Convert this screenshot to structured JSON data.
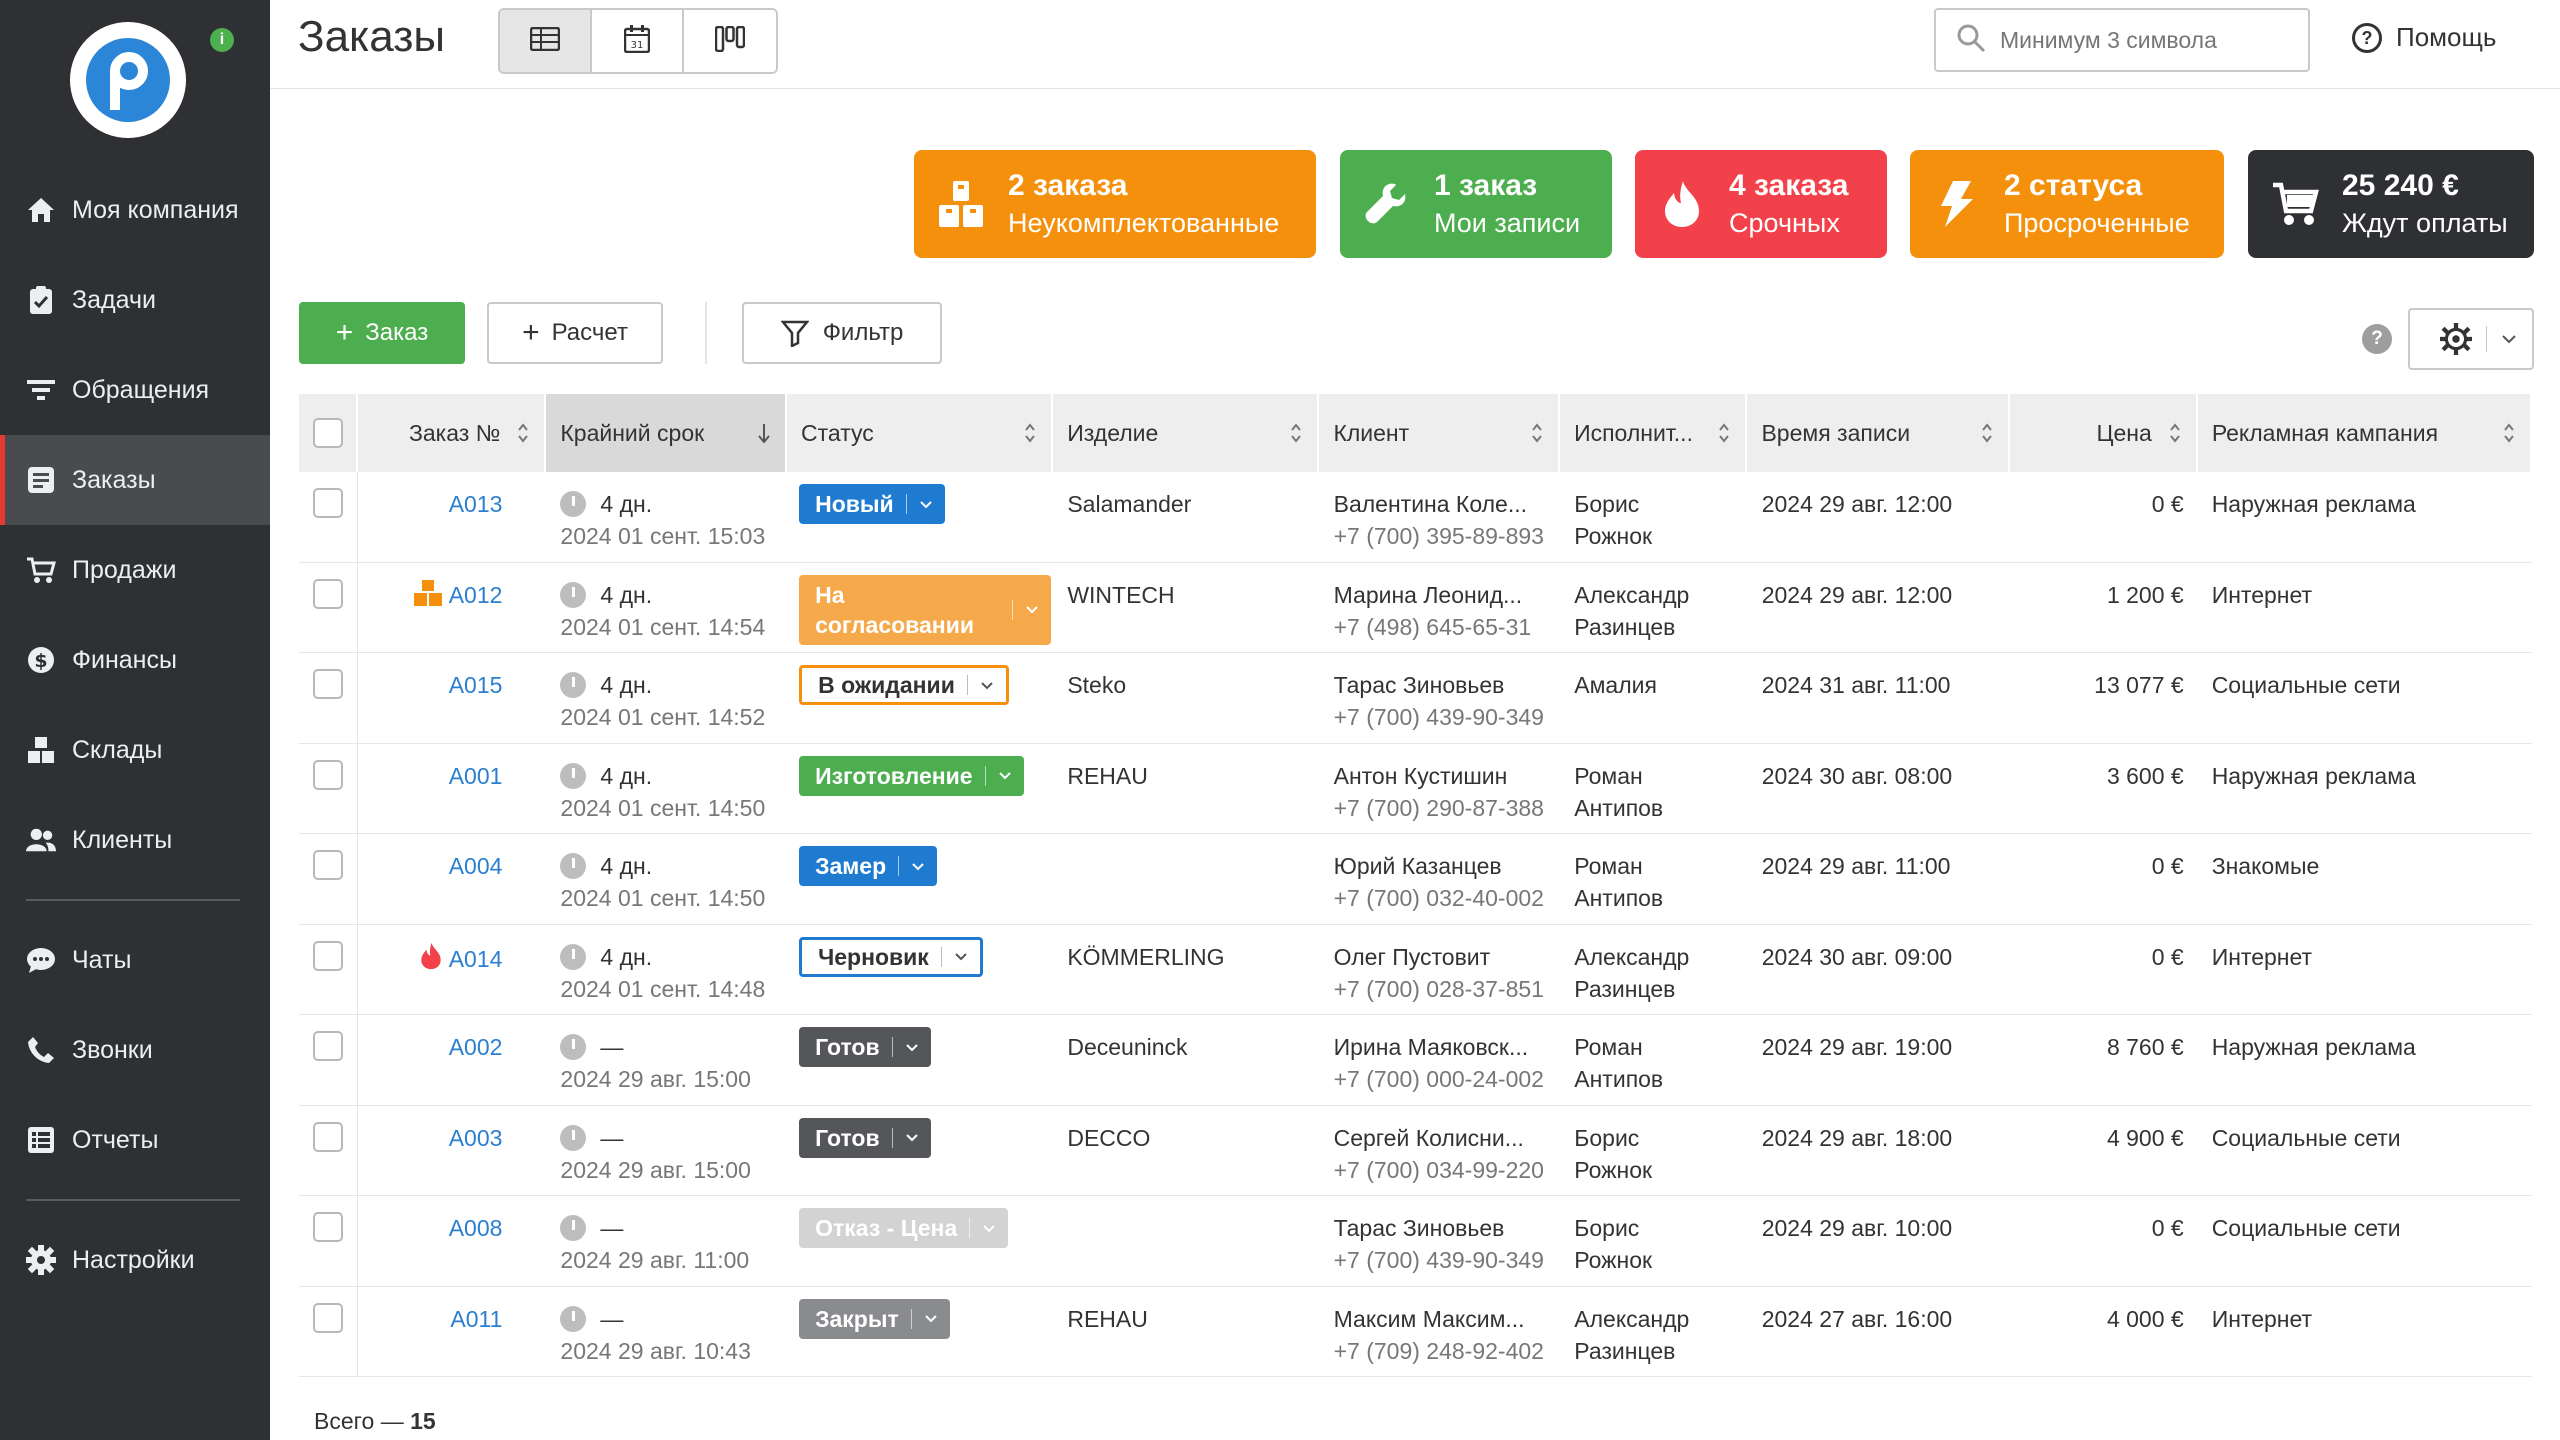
{
  "sidebar": {
    "items": [
      {
        "label": "Моя компания",
        "icon": "home-icon"
      },
      {
        "label": "Задачи",
        "icon": "clipboard-check-icon"
      },
      {
        "label": "Обращения",
        "icon": "funnel-lines-icon"
      },
      {
        "label": "Заказы",
        "icon": "orders-icon",
        "active": true
      },
      {
        "label": "Продажи",
        "icon": "cart-icon"
      },
      {
        "label": "Финансы",
        "icon": "dollar-icon"
      },
      {
        "label": "Склады",
        "icon": "boxes-icon"
      },
      {
        "label": "Клиенты",
        "icon": "users-icon"
      },
      {
        "label": "Чаты",
        "icon": "chat-icon"
      },
      {
        "label": "Звонки",
        "icon": "phone-icon"
      },
      {
        "label": "Отчеты",
        "icon": "reports-icon"
      },
      {
        "label": "Настройки",
        "icon": "gear-icon"
      }
    ]
  },
  "header": {
    "title": "Заказы",
    "search_placeholder": "Минимум 3 символа",
    "help_label": "Помощь"
  },
  "cards": [
    {
      "line1": "2 заказа",
      "line2": "Неукомплектованные",
      "color": "#f4900c",
      "icon": "boxes-icon"
    },
    {
      "line1": "1 заказ",
      "line2": "Мои записи",
      "color": "#4cae4f",
      "icon": "wrench-icon"
    },
    {
      "line1": "4 заказа",
      "line2": "Срочных",
      "color": "#f2414a",
      "icon": "flame-icon"
    },
    {
      "line1": "2 статуса",
      "line2": "Просроченные",
      "color": "#f4900c",
      "icon": "lightning-icon"
    },
    {
      "line1": "25 240 €",
      "line2": "Ждут оплаты",
      "color": "#2f3033",
      "icon": "cart-icon"
    }
  ],
  "toolbar": {
    "add_order": "Заказ",
    "calc": "Расчет",
    "filter": "Фильтр"
  },
  "table": {
    "columns": [
      "Заказ №",
      "Крайний срок",
      "Статус",
      "Изделие",
      "Клиент",
      "Исполнит...",
      "Время записи",
      "Цена",
      "Рекламная кампания"
    ],
    "rows": [
      {
        "num": "A013",
        "flag": "",
        "deadline": "4 дн.",
        "deadline_date": "2024 01 сент. 15:03",
        "status": "Новый",
        "status_color": "#1f7bd0",
        "status_style": "filled",
        "product": "Salamander",
        "client": "Валентина Коле...",
        "phone": "+7 (700) 395-89-893",
        "exec1": "Борис",
        "exec2": "Рожнок",
        "time": "2024 29 авг. 12:00",
        "price": "0 €",
        "campaign": "Наружная реклама"
      },
      {
        "num": "A012",
        "flag": "boxes",
        "deadline": "4 дн.",
        "deadline_date": "2024 01 сент. 14:54",
        "status": "На согласовании",
        "status_color": "#f5a94a",
        "status_style": "filled-two",
        "product": "WINTECH",
        "client": "Марина Леонид...",
        "phone": "+7 (498) 645-65-31",
        "exec1": "Александр",
        "exec2": "Разинцев",
        "time": "2024 29 авг. 12:00",
        "price": "1 200 €",
        "campaign": "Интернет"
      },
      {
        "num": "A015",
        "flag": "",
        "deadline": "4 дн.",
        "deadline_date": "2024 01 сент. 14:52",
        "status": "В ожидании",
        "status_color": "#f4900c",
        "status_style": "outline",
        "product": "Steko",
        "client": "Тарас Зиновьев",
        "phone": "+7 (700) 439-90-349",
        "exec1": "Амалия",
        "exec2": "",
        "time": "2024 31 авг. 11:00",
        "price": "13 077 €",
        "campaign": "Социальные сети"
      },
      {
        "num": "A001",
        "flag": "",
        "deadline": "4 дн.",
        "deadline_date": "2024 01 сент. 14:50",
        "status": "Изготовление",
        "status_color": "#4cae4f",
        "status_style": "filled",
        "product": "REHAU",
        "client": "Антон Кустишин",
        "phone": "+7 (700) 290-87-388",
        "exec1": "Роман",
        "exec2": "Антипов",
        "time": "2024 30 авг. 08:00",
        "price": "3 600 €",
        "campaign": "Наружная реклама"
      },
      {
        "num": "A004",
        "flag": "",
        "deadline": "4 дн.",
        "deadline_date": "2024 01 сент. 14:50",
        "status": "Замер",
        "status_color": "#1f7bd0",
        "status_style": "filled",
        "product": "",
        "client": "Юрий Казанцев",
        "phone": "+7 (700) 032-40-002",
        "exec1": "Роман",
        "exec2": "Антипов",
        "time": "2024 29 авг. 11:00",
        "price": "0 €",
        "campaign": "Знакомые"
      },
      {
        "num": "A014",
        "flag": "flame",
        "deadline": "4 дн.",
        "deadline_date": "2024 01 сент. 14:48",
        "status": "Черновик",
        "status_color": "#1f7bd0",
        "status_style": "outline",
        "product": "KÖMMERLING",
        "client": "Олег Пустовит",
        "phone": "+7 (700) 028-37-851",
        "exec1": "Александр",
        "exec2": "Разинцев",
        "time": "2024 30 авг. 09:00",
        "price": "0 €",
        "campaign": "Интернет"
      },
      {
        "num": "A002",
        "flag": "",
        "deadline": "—",
        "deadline_date": "2024 29 авг. 15:00",
        "status": "Готов",
        "status_color": "#555659",
        "status_style": "filled",
        "product": "Deceuninck",
        "client": "Ирина Маяковск...",
        "phone": "+7 (700) 000-24-002",
        "exec1": "Роман",
        "exec2": "Антипов",
        "time": "2024 29 авг. 19:00",
        "price": "8 760 €",
        "campaign": "Наружная реклама"
      },
      {
        "num": "A003",
        "flag": "",
        "deadline": "—",
        "deadline_date": "2024 29 авг. 15:00",
        "status": "Готов",
        "status_color": "#555659",
        "status_style": "filled",
        "product": "DECCO",
        "client": "Сергей Колисни...",
        "phone": "+7 (700) 034-99-220",
        "exec1": "Борис",
        "exec2": "Рожнок",
        "time": "2024 29 авг. 18:00",
        "price": "4 900 €",
        "campaign": "Социальные сети"
      },
      {
        "num": "A008",
        "flag": "",
        "deadline": "—",
        "deadline_date": "2024 29 авг. 11:00",
        "status": "Отказ - Цена",
        "status_color": "#d3d3d3",
        "status_style": "filled",
        "product": "",
        "client": "Тарас Зиновьев",
        "phone": "+7 (700) 439-90-349",
        "exec1": "Борис",
        "exec2": "Рожнок",
        "time": "2024 29 авг. 10:00",
        "price": "0 €",
        "campaign": "Социальные сети"
      },
      {
        "num": "A011",
        "flag": "",
        "deadline": "—",
        "deadline_date": "2024 29 авг. 10:43",
        "status": "Закрыт",
        "status_color": "#8a8b8e",
        "status_style": "filled",
        "product": "REHAU",
        "client": "Максим Максим...",
        "phone": "+7 (709) 248-92-402",
        "exec1": "Александр",
        "exec2": "Разинцев",
        "time": "2024 27 авг. 16:00",
        "price": "4 000 €",
        "campaign": "Интернет"
      }
    ]
  },
  "footer": {
    "total_label": "Всего —",
    "total_value": "15"
  }
}
